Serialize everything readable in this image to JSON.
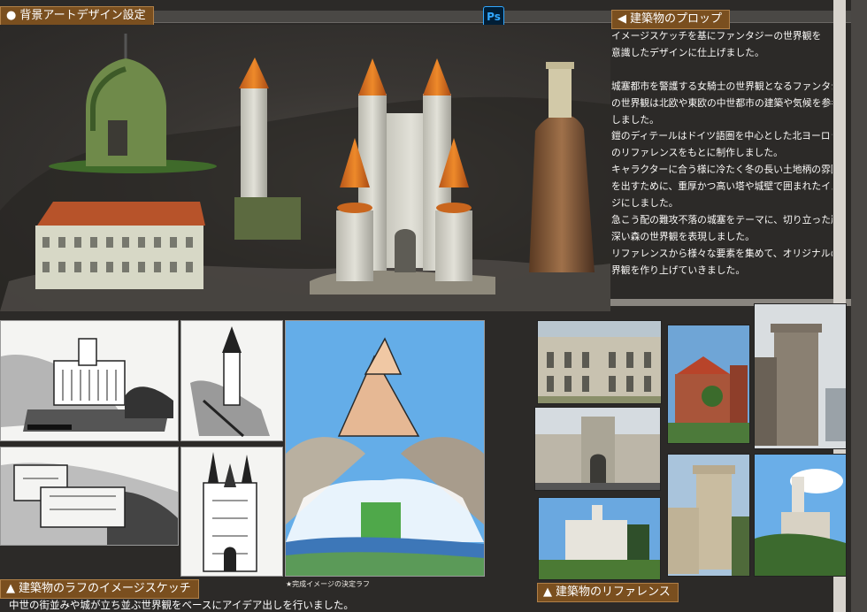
{
  "section_background": {
    "title": "背景アートデザイン設定",
    "marker": "●"
  },
  "section_props": {
    "title": "建築物のプロップ",
    "marker": "◀",
    "lines": [
      "イメージスケッチを基にファンタジーの世界観を",
      "意識したデザインに仕上げました。",
      "",
      "城塞都市を警護する女騎士の世界観となるファンタジー",
      "の世界観は北欧や東欧の中世都市の建築や気候を参考に",
      "しました。",
      "鎧のディテールはドイツ語圏を中心とした北ヨーロッパ",
      "のリファレンスをもとに制作しました。",
      "キャラクターに合う様に冷たく冬の長い土地柄の雰囲気",
      "を出すために、重厚かつ高い塔や城壁で囲まれたイメー",
      "ジにしました。",
      "急こう配の難攻不落の城塞をテーマに、切り立った崖や",
      "深い森の世界観を表現しました。",
      "リファレンスから様々な要素を集めて、オリジナルの世",
      "界観を作り上げていきました。"
    ]
  },
  "section_sketch": {
    "title": "建築物のラフのイメージスケッチ",
    "marker": "▲",
    "caption": "★完成イメージの決定ラフ",
    "description": "中世の街並みや城が立ち並ぶ世界観をベースにアイデア出しを行いました。"
  },
  "section_reference": {
    "title": "建築物のリファレンス",
    "marker": "▲"
  },
  "app_badge": "Ps",
  "colors": {
    "header_bg": "#7a4f1f",
    "panel_bg": "#2c2a28",
    "sky": "#6aaee8"
  }
}
